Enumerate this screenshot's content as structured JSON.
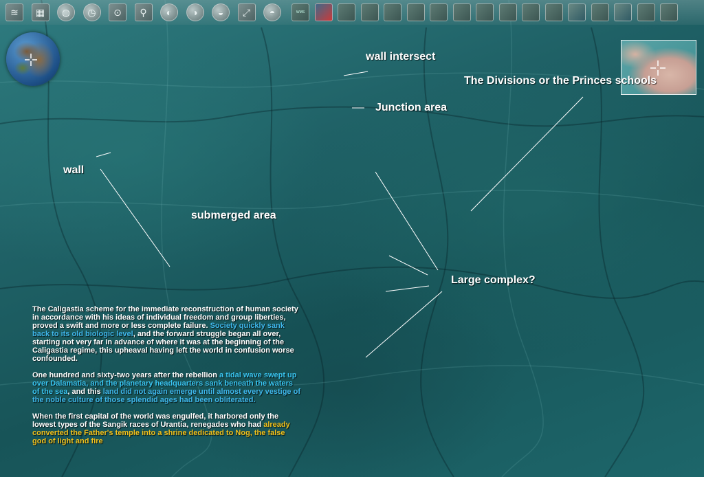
{
  "toolbar": {
    "tools": [
      {
        "name": "layers-icon",
        "glyph": "≋"
      },
      {
        "name": "grid-icon",
        "glyph": "▦"
      },
      {
        "name": "globe-grid-icon",
        "glyph": "◍"
      },
      {
        "name": "clock-icon",
        "glyph": "◷"
      },
      {
        "name": "compass-icon",
        "glyph": "⊙"
      },
      {
        "name": "search-icon",
        "glyph": "⚲"
      },
      {
        "name": "earth-icon",
        "glyph": "◐"
      },
      {
        "name": "planet-icon",
        "glyph": "◑"
      },
      {
        "name": "sky-icon",
        "glyph": "◒"
      },
      {
        "name": "ruler-icon",
        "glyph": "⤢"
      },
      {
        "name": "ocean-layer-icon",
        "glyph": "◓"
      }
    ],
    "layer_thumbnails": [
      {
        "name": "wms-layer-icon",
        "text": "WMS"
      },
      {
        "name": "layer-thumb-2",
        "text": ""
      },
      {
        "name": "layer-thumb-3",
        "text": ""
      },
      {
        "name": "layer-thumb-4",
        "text": ""
      },
      {
        "name": "layer-thumb-5",
        "text": ""
      },
      {
        "name": "layer-thumb-6",
        "text": ""
      },
      {
        "name": "layer-thumb-7",
        "text": ""
      },
      {
        "name": "layer-thumb-8",
        "text": ""
      },
      {
        "name": "layer-thumb-9",
        "text": ""
      },
      {
        "name": "layer-thumb-10",
        "text": ""
      },
      {
        "name": "layer-thumb-11",
        "text": ""
      },
      {
        "name": "layer-thumb-12",
        "text": ""
      },
      {
        "name": "layer-thumb-13",
        "text": ""
      },
      {
        "name": "layer-thumb-14",
        "text": ""
      },
      {
        "name": "layer-thumb-15",
        "text": ""
      },
      {
        "name": "layer-thumb-16",
        "text": ""
      },
      {
        "name": "layer-thumb-17",
        "text": ""
      }
    ]
  },
  "labels": {
    "wall_intersect": "wall intersect",
    "junction_area": "Junction area",
    "divisions": "The Divisions or the  Princes schools",
    "wall": "wall",
    "submerged_area": "submerged area",
    "large_complex": "Large complex?"
  },
  "quote": {
    "p1_a": "The Caligastia scheme for the immediate reconstruction of human society in accordance with his ideas of individual freedom and group liberties, proved a swift and more or less complete failure.",
    "p1_hl": "Society quickly sank back to its old biologic level",
    "p1_b": ", and the forward struggle began all over, starting not very far in advance of where it was at the beginning of the Caligastia regime, this upheaval having left the world in confusion worse confounded.",
    "p2_a": "One hundred and sixty-two years after the rebellion ",
    "p2_hl1": "a tidal wave swept up over Dalamatia, and the planetary headquarters sank beneath the waters of the sea",
    "p2_b": ", and this ",
    "p2_hl2": "land did not again emerge until almost every vestige of the noble culture of those splendid ages had been obliterated.",
    "p3_a": "When the first capital of the world was engulfed, it harbored only the lowest types of the Sangik races of Urantia, renegades who had ",
    "p3_hl": "already converted the Father's temple into a shrine dedicated to Nog, the false god of light and fire"
  },
  "colors": {
    "highlight_blue": "#3fb8ec",
    "highlight_gold": "#f2c21c",
    "label_white": "#ffffff"
  }
}
